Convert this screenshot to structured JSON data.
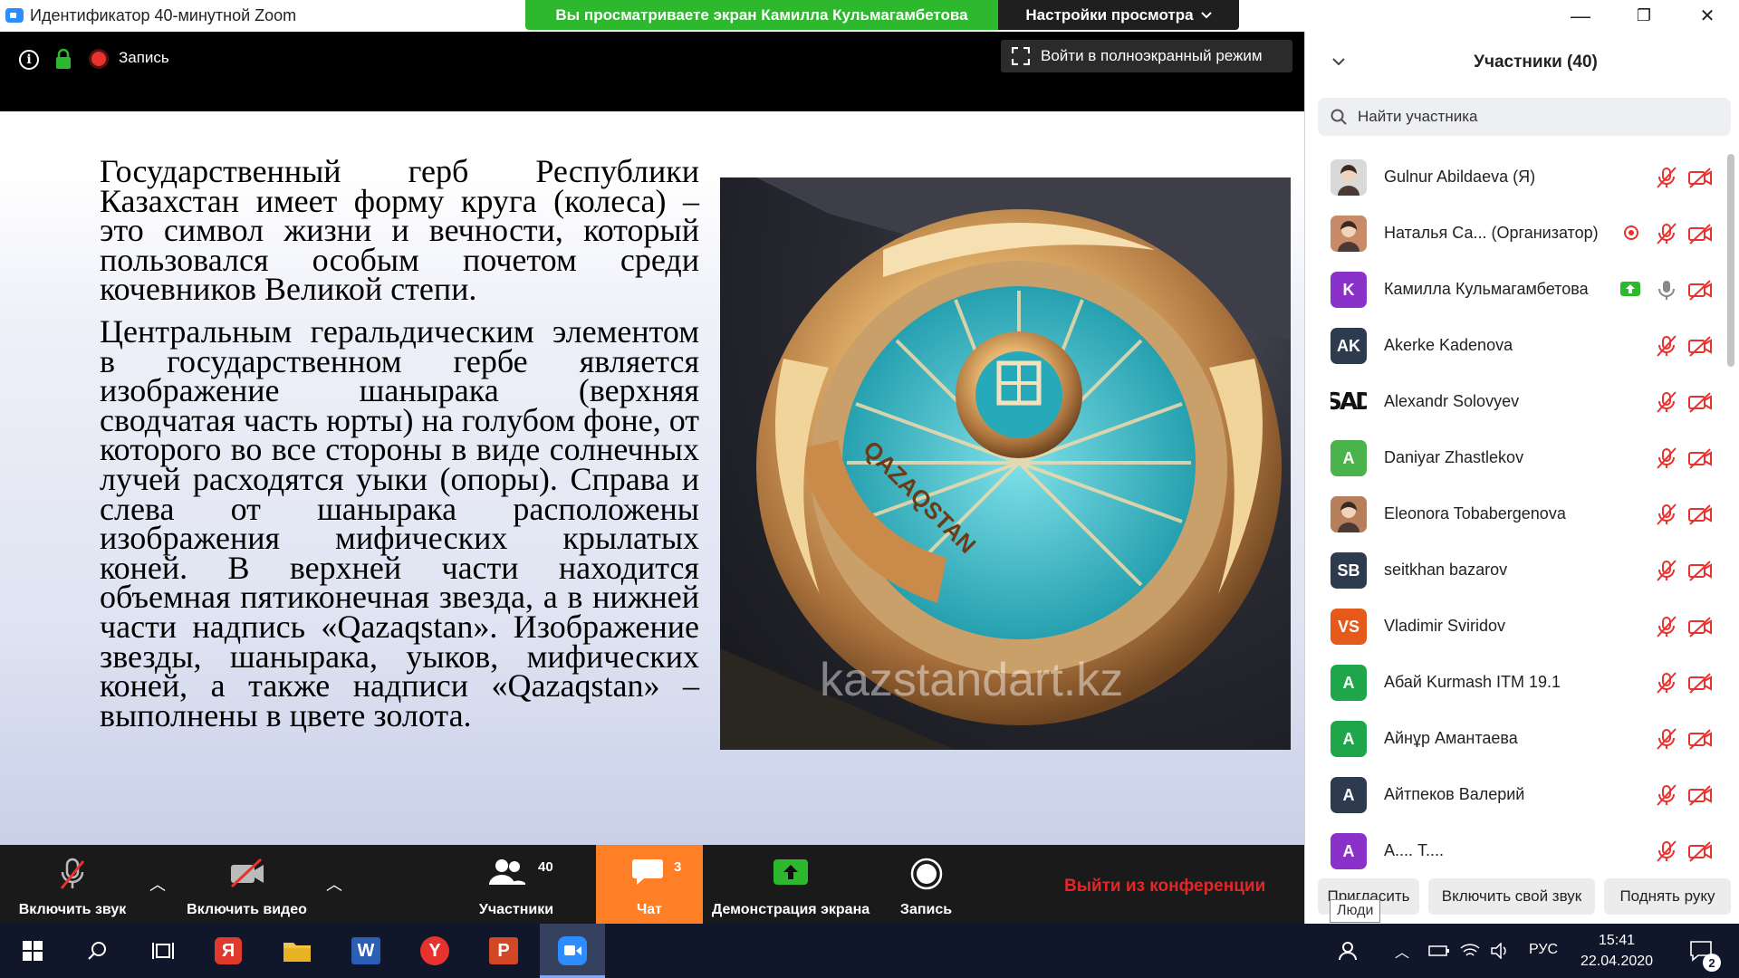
{
  "window": {
    "title": "Идентификатор 40-минутной Zoom",
    "share_banner": "Вы просматриваете экран Камилла Кульмагамбетова",
    "view_settings": "Настройки просмотра",
    "controls": {
      "minimize": "—",
      "maximize": "❐",
      "close": "✕"
    }
  },
  "meeting_header": {
    "recording_label": "Запись",
    "fullscreen_button": "Войти в полноэкранный режим"
  },
  "slide": {
    "paragraphs": [
      "Государственный герб Республики Казахстан имеет форму круга (колеса) – это символ жизни и вечности, который пользовался особым почетом среди кочевников Великой степи.",
      "Центральным геральдическим элементом в государственном гербе является изображение шанырака (верхняя сводчатая часть юрты) на голубом фоне, от которого во все стороны в виде солнечных лучей расходятся уыки (опоры). Справа и слева от шанырака расположены изображения мифических крылатых коней. В верхней части находится объемная пятиконечная звезда, а в нижней части надпись «Qazaqstan». Изображение звезды, шанырака, уыков, мифических коней, а также надписи «Qazaqstan» – выполнены в цвете золота."
    ],
    "photo": {
      "ribbon_text": "QAZAQSTAN",
      "watermark": "kazstandart.kz"
    }
  },
  "toolbar": {
    "audio": "Включить звук",
    "video": "Включить видео",
    "participants": "Участники",
    "participants_count": "40",
    "chat": "Чат",
    "chat_count": "3",
    "share": "Демонстрация экрана",
    "record": "Запись",
    "leave": "Выйти из конференции"
  },
  "participants_panel": {
    "title": "Участники (40)",
    "search_placeholder": "Найти участника",
    "participants": [
      {
        "name": "Gulnur Abildaeva (Я)",
        "avatar": "photo",
        "color": "#d9d9d9",
        "mic": "muted",
        "cam": "off"
      },
      {
        "name": "Наталья Са...  (Организатор)",
        "avatar": "photo",
        "color": "#c98a6a",
        "mic": "muted",
        "cam": "off",
        "badge": "cohost"
      },
      {
        "name": "Камилла Кульмагамбетова",
        "initials": "K",
        "color": "#8a31c9",
        "mic": "on",
        "cam": "off",
        "badge": "sharing"
      },
      {
        "name": "Akerke Kadenova",
        "initials": "AK",
        "color": "#2e3a4e",
        "mic": "muted",
        "cam": "off"
      },
      {
        "name": "Alexandr Solovyev",
        "initials": "SAD",
        "color": "#ffffff",
        "mic": "muted",
        "cam": "off"
      },
      {
        "name": "Daniyar Zhastlekov",
        "initials": "A",
        "color": "#4bb34b",
        "mic": "muted",
        "cam": "off"
      },
      {
        "name": "Eleonora Tobabergenova",
        "avatar": "photo",
        "color": "#b87f5d",
        "mic": "muted",
        "cam": "off"
      },
      {
        "name": "seitkhan bazarov",
        "initials": "SB",
        "color": "#2e3a4e",
        "mic": "muted",
        "cam": "off"
      },
      {
        "name": "Vladimir Sviridov",
        "initials": "VS",
        "color": "#e5591b",
        "mic": "muted",
        "cam": "off"
      },
      {
        "name": "Абай Kurmash ITM 19.1",
        "initials": "A",
        "color": "#1fa54a",
        "mic": "muted",
        "cam": "off"
      },
      {
        "name": "Айнұр Амантаева",
        "initials": "A",
        "color": "#1fa54a",
        "mic": "muted",
        "cam": "off"
      },
      {
        "name": "Айтпеков Валерий",
        "initials": "A",
        "color": "#2e3a4e",
        "mic": "muted",
        "cam": "off"
      },
      {
        "name": "А.... Т....",
        "initials": "A",
        "color": "#8a31c9",
        "mic": "muted",
        "cam": "off"
      }
    ],
    "footer": {
      "invite": "Пригласить",
      "unmute_self": "Включить свой звук",
      "raise_hand": "Поднять руку",
      "tooltip": "Люди"
    }
  },
  "taskbar": {
    "language": "РУС",
    "time": "15:41",
    "date": "22.04.2020",
    "notifications": "2"
  },
  "colors": {
    "zoom_blue": "#2d8cff",
    "share_green": "#2db82d",
    "chat_orange": "#ff7f27",
    "leave_red": "#e02828",
    "muted_red": "#e8322e"
  }
}
